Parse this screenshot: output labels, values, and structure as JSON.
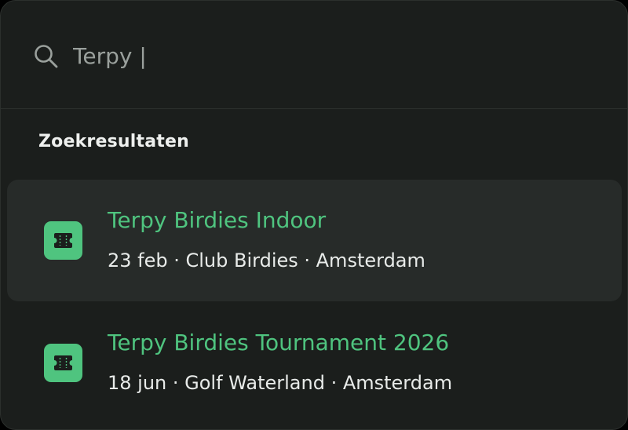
{
  "search": {
    "value": "Terpy |",
    "icon": "search-icon"
  },
  "results_section": {
    "title": "Zoekresultaten"
  },
  "results": [
    {
      "title": "Terpy Birdies Indoor",
      "date": "23 feb",
      "venue": "Club Birdies",
      "city": "Amsterdam",
      "meta": "23 feb · Club Birdies · Amsterdam",
      "icon": "ticket-icon",
      "selected": true
    },
    {
      "title": "Terpy Birdies Tournament 2026",
      "date": "18 jun",
      "venue": "Golf Waterland",
      "city": "Amsterdam",
      "meta": "18 jun · Golf Waterland · Amsterdam",
      "icon": "ticket-icon",
      "selected": false
    }
  ],
  "colors": {
    "background": "#1b1e1c",
    "highlight_row": "#272b29",
    "accent": "#4fc47f",
    "text_primary": "#eef0ee",
    "text_muted": "#9aa09c"
  }
}
